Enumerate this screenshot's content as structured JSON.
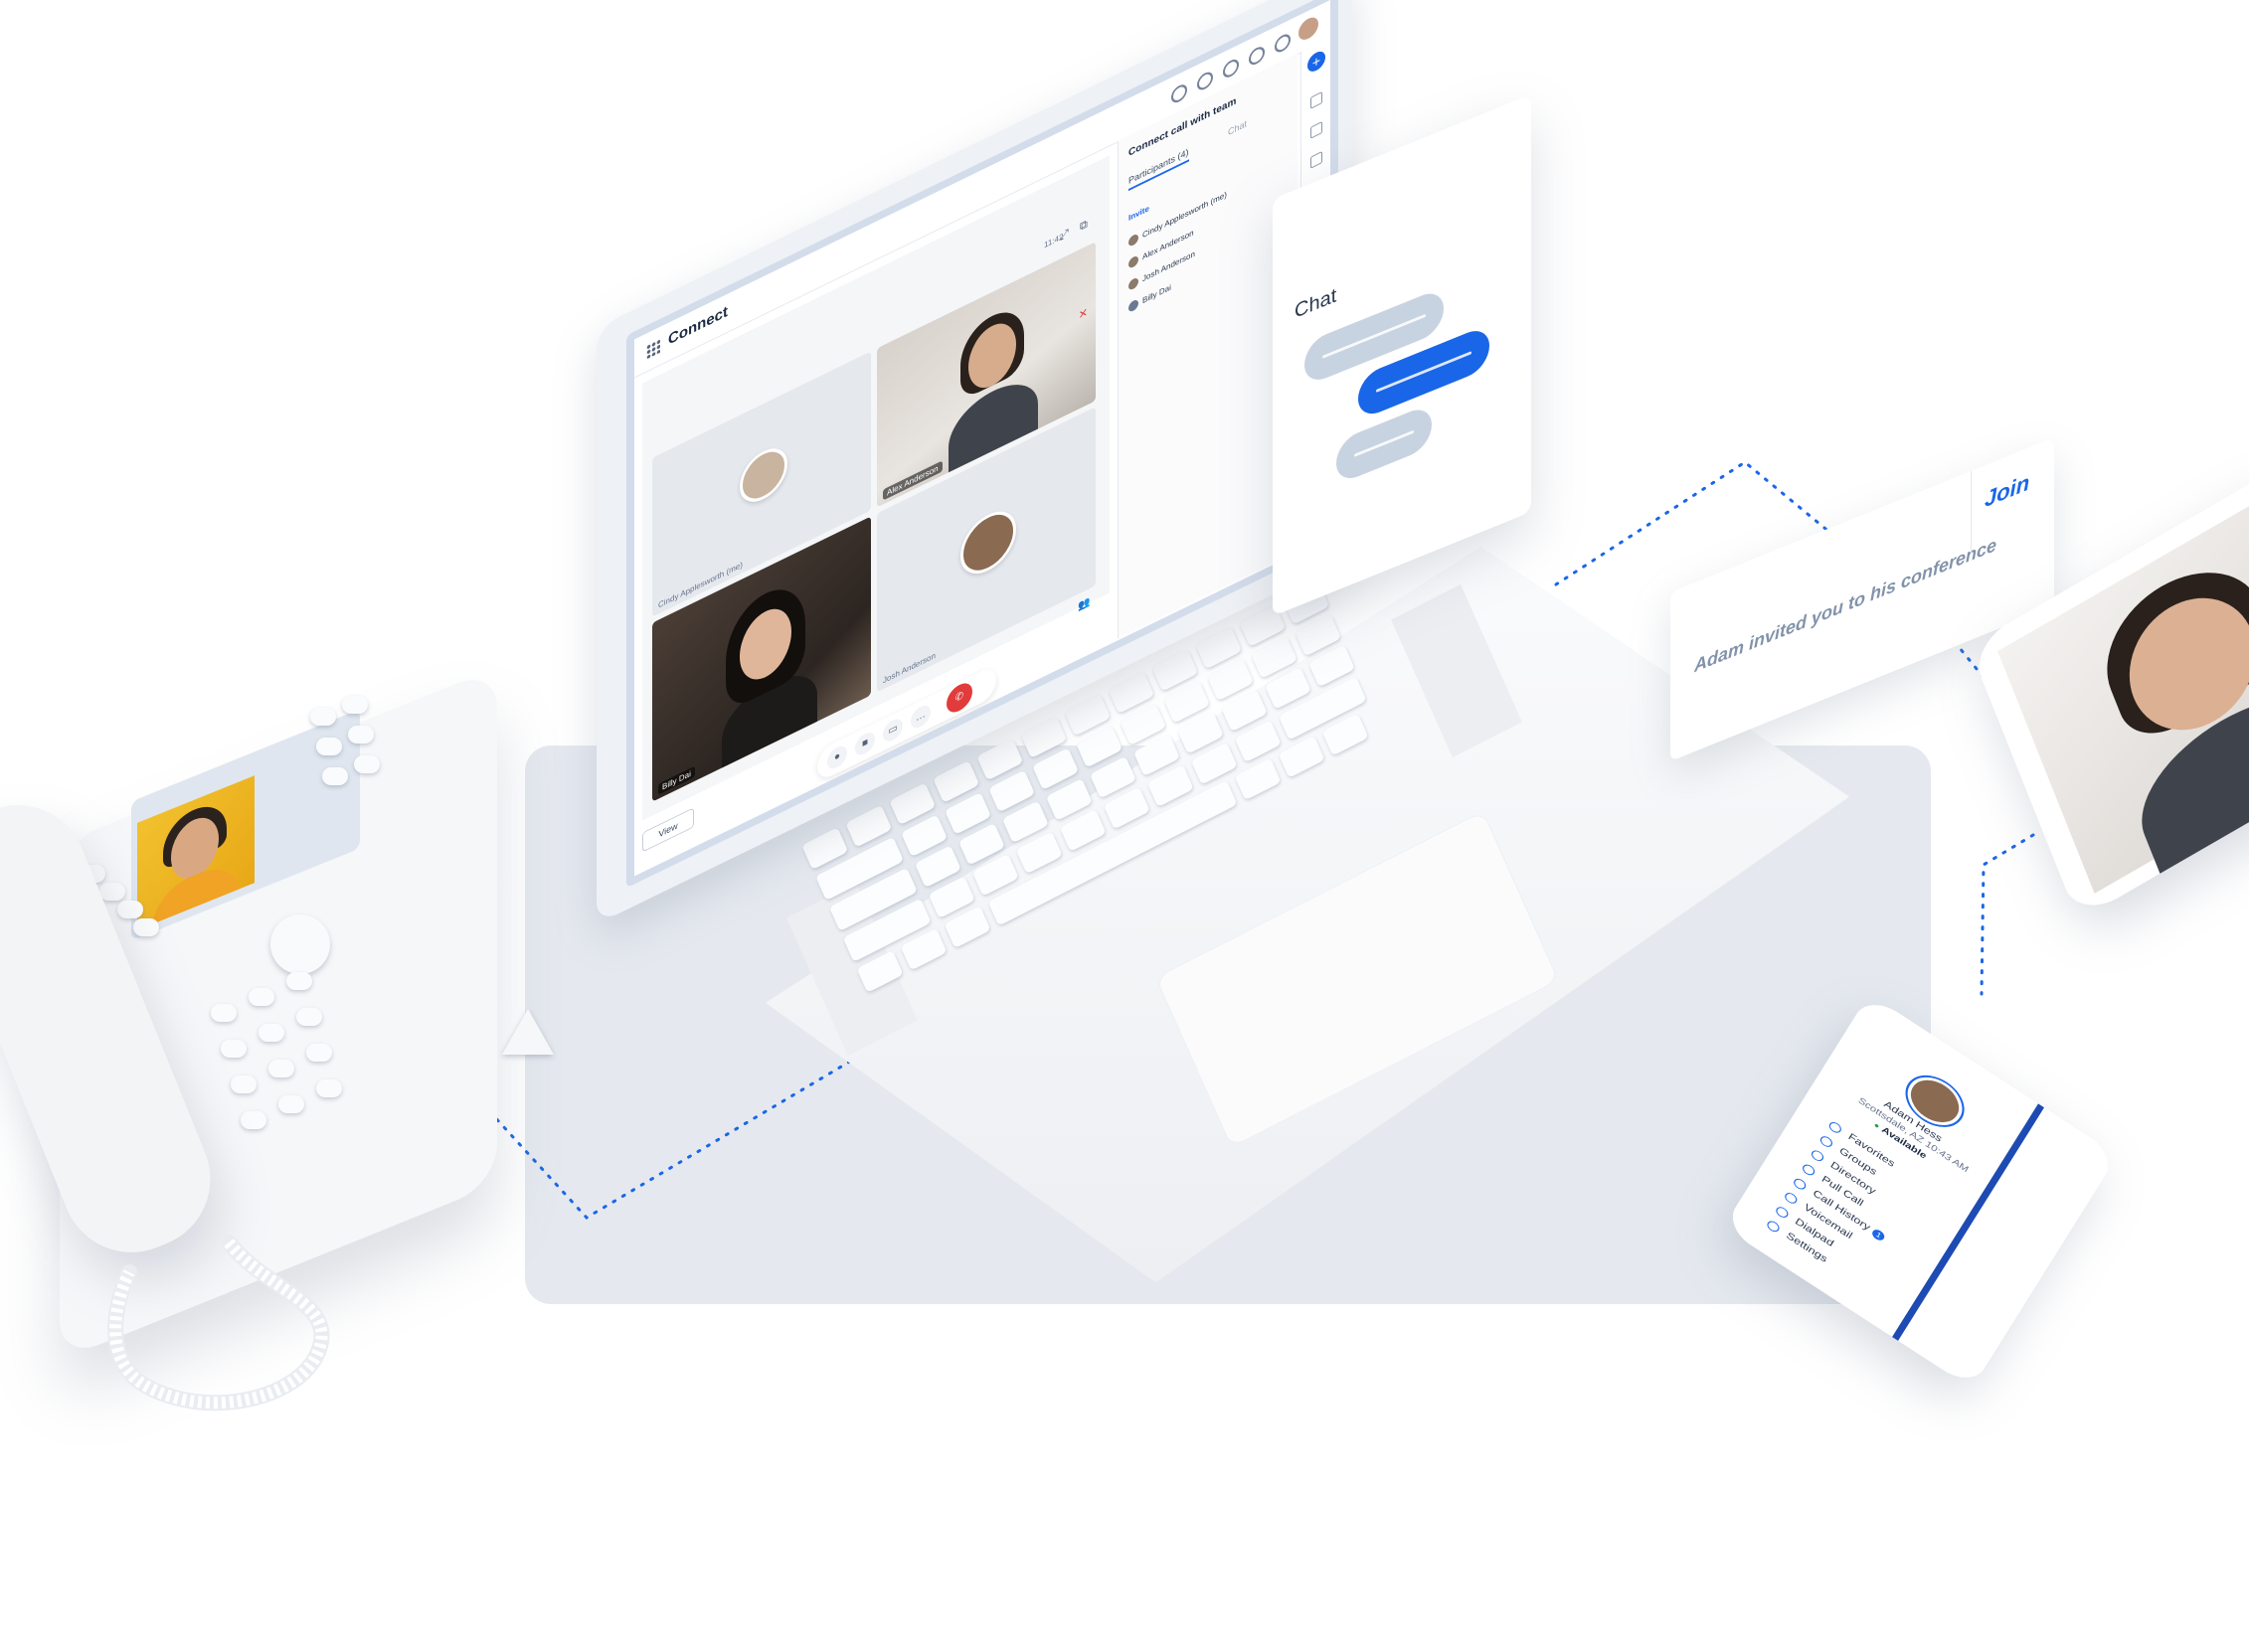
{
  "app": {
    "title": "Connect",
    "timer": "11:42",
    "view_label": "View"
  },
  "call": {
    "panel_title": "Connect call with team",
    "tabs": [
      {
        "label": "Participants (4)",
        "active": true
      },
      {
        "label": "Chat",
        "active": false
      }
    ],
    "invite_label": "Invite",
    "participants": [
      {
        "name": "Cindy Applesworth (me)"
      },
      {
        "name": "Alex Anderson"
      },
      {
        "name": "Josh Anderson"
      },
      {
        "name": "Billy Dai"
      }
    ],
    "tiles": [
      {
        "name": "Cindy Applesworth (me)",
        "type": "avatar"
      },
      {
        "name": "Alex Anderson",
        "type": "video"
      },
      {
        "name": "Billy Dai",
        "type": "video"
      },
      {
        "name": "Josh Anderson",
        "type": "avatar"
      }
    ]
  },
  "chat_card": {
    "title": "Chat"
  },
  "invite_card": {
    "message": "Adam invited you to his conference",
    "join_label": "Join"
  },
  "mobile_menu": {
    "name": "Adam Hess",
    "location": "Scottsdale, AZ 10:43 AM",
    "status": "Available",
    "items": [
      {
        "label": "Favorites"
      },
      {
        "label": "Groups"
      },
      {
        "label": "Directory"
      },
      {
        "label": "Pull Call"
      },
      {
        "label": "Call History",
        "badge": "1"
      },
      {
        "label": "Voicemail"
      },
      {
        "label": "Dialpad"
      },
      {
        "label": "Settings"
      }
    ]
  },
  "colors": {
    "accent": "#1a66e8",
    "end_call": "#e23b3b",
    "backdrop": "#e5e9ef",
    "connector": "#1a66e8"
  }
}
